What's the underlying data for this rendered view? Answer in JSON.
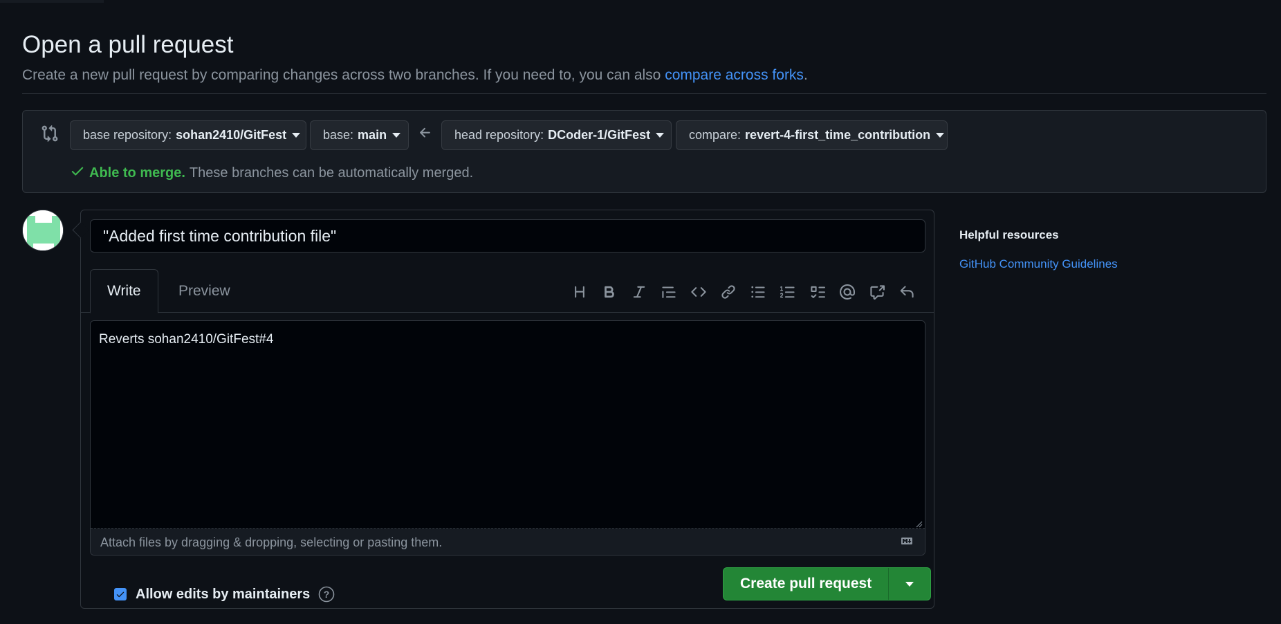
{
  "header": {
    "title": "Open a pull request",
    "subtitle_text": "Create a new pull request by comparing changes across two branches. If you need to, you can also ",
    "subtitle_link": "compare across forks",
    "subtitle_end": "."
  },
  "range": {
    "base_repo_key": "base repository:",
    "base_repo_value": "sohan2410/GitFest",
    "base_key": "base:",
    "base_value": "main",
    "head_repo_key": "head repository:",
    "head_repo_value": "DCoder-1/GitFest",
    "compare_key": "compare:",
    "compare_value": "revert-4-first_time_contribution",
    "merge_ok": "Able to merge.",
    "merge_text": "These branches can be automatically merged."
  },
  "form": {
    "title_value": "\"Added first time contribution file\"",
    "tabs": [
      "Write",
      "Preview"
    ],
    "toolbar_icons": [
      "heading-icon",
      "bold-icon",
      "italic-icon",
      "quote-icon",
      "code-icon",
      "link-icon",
      "unordered-list-icon",
      "ordered-list-icon",
      "task-list-icon",
      "mention-icon",
      "cross-reference-icon",
      "reply-icon"
    ],
    "body_value": "Reverts sohan2410/GitFest#4",
    "attach_text": "Attach files by dragging & dropping, selecting or pasting them.",
    "allow_edits_label": "Allow edits by maintainers",
    "allow_edits_checked": true,
    "create_label": "Create pull request"
  },
  "sidebar": {
    "heading": "Helpful resources",
    "link": "GitHub Community Guidelines"
  },
  "colors": {
    "background": "#0d1117",
    "accent_link": "#4493f8",
    "success": "#3fb950",
    "button_green": "#238636"
  }
}
